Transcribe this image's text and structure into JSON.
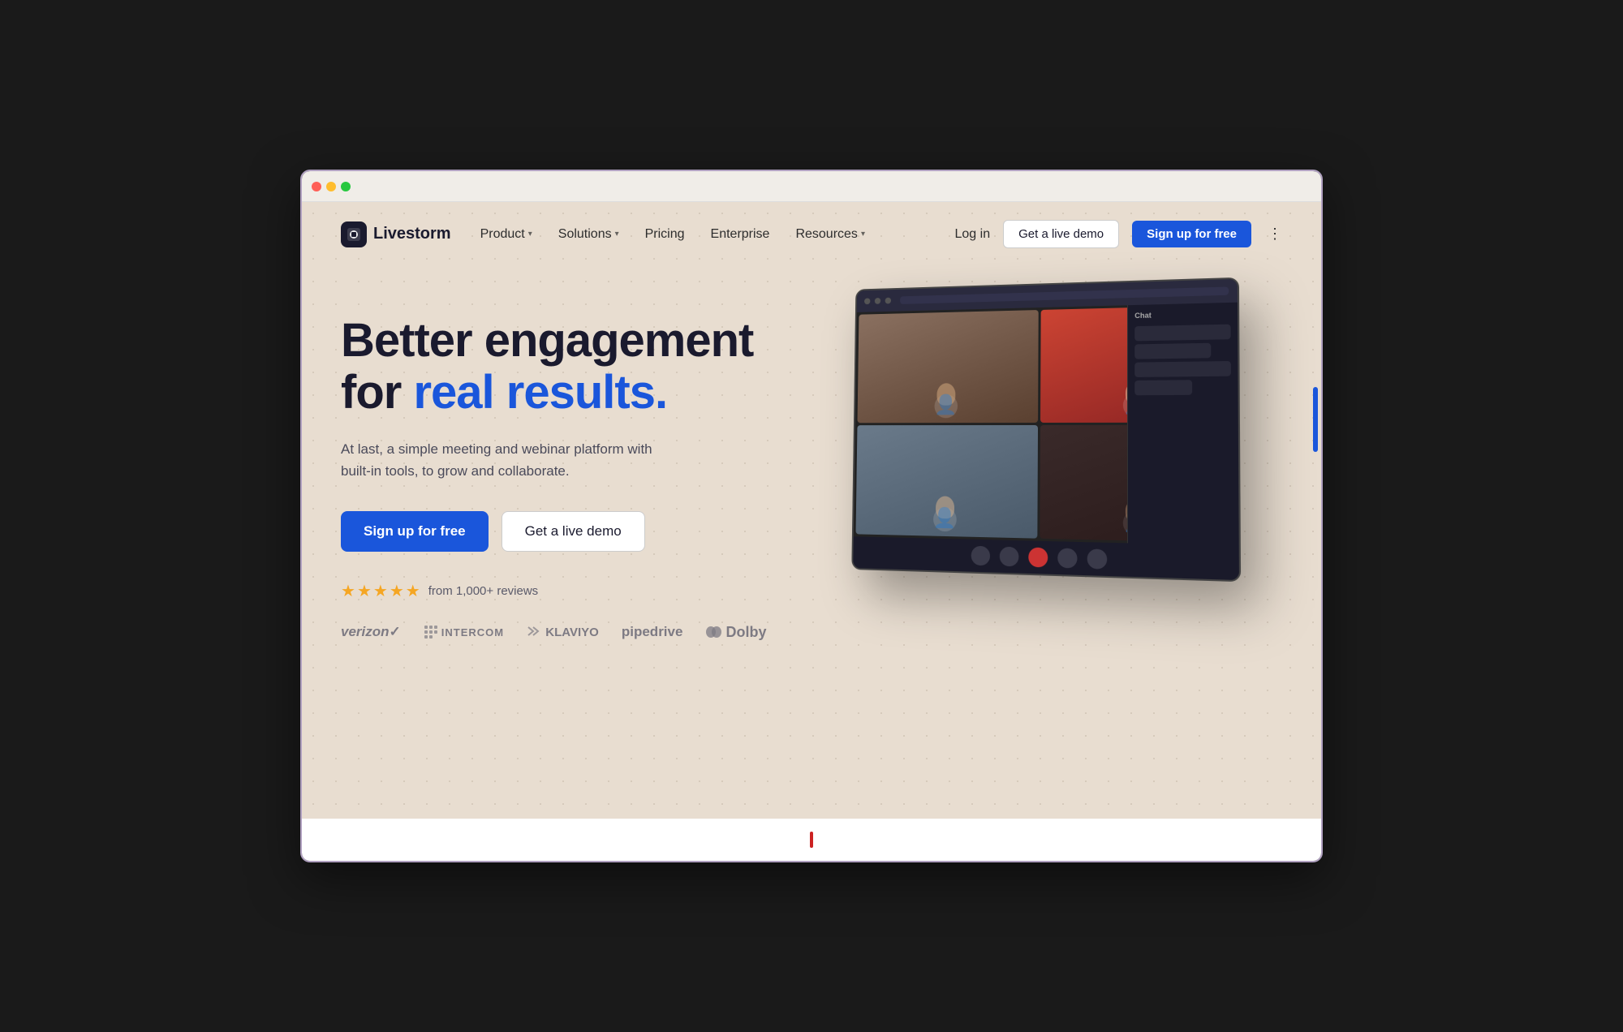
{
  "browser": {
    "dots": [
      "red",
      "yellow",
      "green"
    ]
  },
  "nav": {
    "logo_text": "Livestorm",
    "links": [
      {
        "label": "Product",
        "has_dropdown": true
      },
      {
        "label": "Solutions",
        "has_dropdown": true
      },
      {
        "label": "Pricing",
        "has_dropdown": false
      },
      {
        "label": "Enterprise",
        "has_dropdown": false
      },
      {
        "label": "Resources",
        "has_dropdown": true
      }
    ],
    "login": "Log in",
    "demo_btn": "Get a live demo",
    "signup_btn": "Sign up for free"
  },
  "hero": {
    "title_line1": "Better engagement",
    "title_line2": "for ",
    "title_highlight": "real results.",
    "subtitle": "At last, a simple meeting and webinar platform with built-in tools, to grow and collaborate.",
    "cta_primary": "Sign up for free",
    "cta_secondary": "Get a live demo",
    "reviews_text": "from 1,000+ reviews",
    "stars": 5
  },
  "brands": [
    {
      "label": "verizon✓",
      "class": "verizon"
    },
    {
      "label": "INTERCOM",
      "class": "intercom"
    },
    {
      "label": "⌒ KLAVIYO",
      "class": "klaviyo"
    },
    {
      "label": "pipedrive",
      "class": "pipedrive"
    },
    {
      "label": "◀◀ Dolby",
      "class": "dolby"
    }
  ],
  "colors": {
    "accent": "#1a56db",
    "background": "#e8ddd0",
    "dark": "#1a1a2e"
  }
}
